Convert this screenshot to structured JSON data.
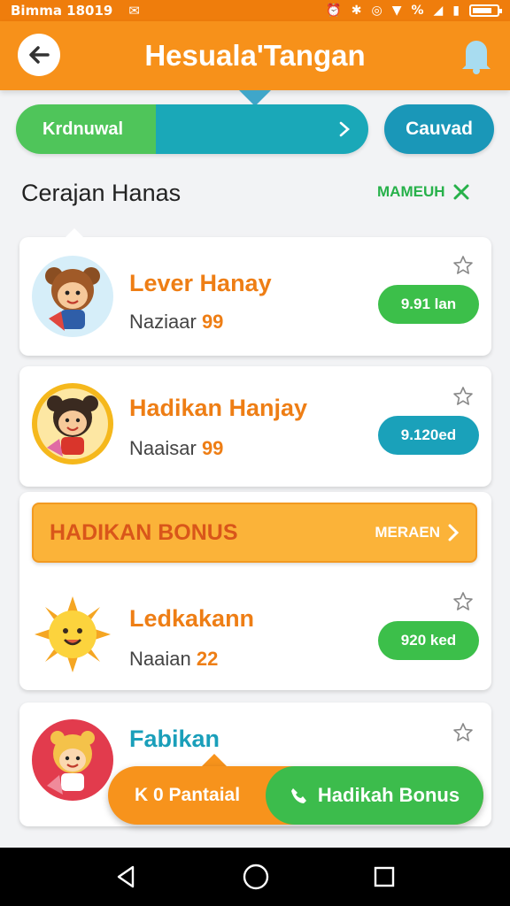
{
  "status_bar": {
    "carrier": "Bimma 18019",
    "right_text": "%"
  },
  "header": {
    "title": "Hesuala'Tangan",
    "back_icon": "back-arrow-icon",
    "bell_icon": "bell-icon"
  },
  "filter": {
    "left_label": "Krdnuwal",
    "cancel_label": "Cauvad"
  },
  "section": {
    "title": "Cerajan Hanas",
    "action_label": "MAMEUH"
  },
  "cards": [
    {
      "name": "Lever Hanay",
      "sub_label": "Naziaar",
      "sub_value": "99",
      "button": "9.91 lan",
      "button_color": "#3cbf4a"
    },
    {
      "name": "Hadikan Hanjay",
      "sub_label": "Naaisar",
      "sub_value": "99",
      "button": "9.120ed",
      "button_color": "#1aa1ba"
    },
    {
      "name": "Ledkakann",
      "sub_label": "Naaian",
      "sub_value": "22",
      "button": "920 ked",
      "button_color": "#3cbf4a"
    },
    {
      "name": "Fabikan",
      "sub_label": "",
      "sub_value": "",
      "button": "",
      "button_color": ""
    }
  ],
  "bonus_banner": {
    "title": "HADIKAN BONUS",
    "action": "MERAEN"
  },
  "bottom_action": {
    "left_label": "K 0 Pantaial",
    "right_label": "Hadikah Bonus"
  },
  "colors": {
    "primary_orange": "#f7911a",
    "accent_green": "#3cbf4a",
    "accent_teal": "#1aa1ba",
    "title_orange": "#ee7e15"
  }
}
